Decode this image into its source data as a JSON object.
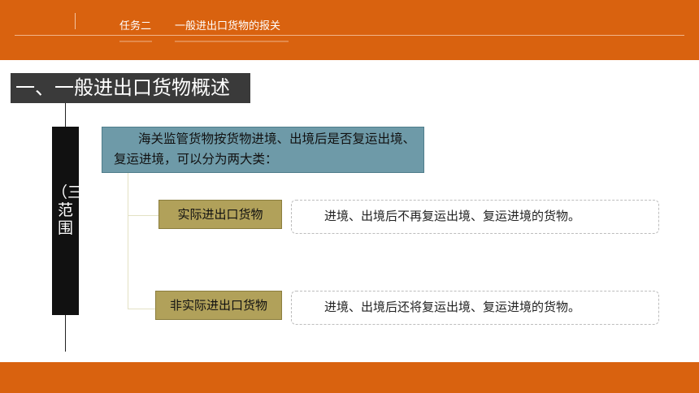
{
  "header": {
    "task_label": "任务二",
    "task_title": "一般进出口货物的报关"
  },
  "section_title": "一、一般进出口货物概述",
  "side_label": "（三）\n范\n围",
  "intro_text": "海关监管货物按货物进境、出境后是否复运出境、复运进境，可以分为两大类：",
  "categories": [
    {
      "label": "实际进出口货物",
      "description": "进境、出境后不再复运出境、复运进境的货物。"
    },
    {
      "label": "非实际进出口货物",
      "description": "进境、出境后还将复运出境、复运进境的货物。"
    }
  ]
}
